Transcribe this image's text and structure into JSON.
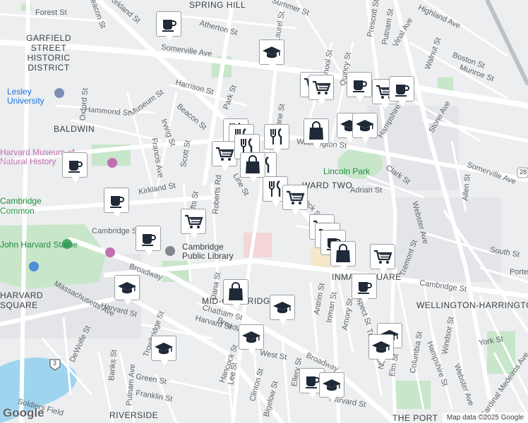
{
  "map": {
    "labels": {
      "district_garfield": "GARFIELD STREET HISTORIC DISTRICT",
      "baldwin": "BALDWIN",
      "spring_hill": "SPRING HILL",
      "ward_two": "WARD TWO",
      "mid_cambridge": "MID-CAMBRIDGE",
      "inman_square": "INMAN SQUARE",
      "wellington_harrington": "WELLINGTON-HARRINGTON",
      "riverside": "RIVERSIDE",
      "the_port": "THE PORT",
      "harvard_square": "HARVARD SQUARE",
      "lesley_university": "Lesley University",
      "harvard_museum": "Harvard Museum of Natural History",
      "cambridge_common": "Cambridge Common",
      "harvard_statue": "John Harvard Statue",
      "cambridge_public_library": "Cambridge Public Library",
      "lincoln_park": "Lincoln Park",
      "route_28": "28",
      "route_3": "3"
    },
    "streets": {
      "forest_st": "Forest St",
      "beacon_st_top": "Beacon St",
      "kirkland_st_top": "Kirkland St",
      "summer_st": "Summer St",
      "highland_ave": "Highland Ave",
      "atherton_st": "Atherton St",
      "laurel_st": "Laurel St",
      "prescott_st": "Prescott St",
      "putnam_st": "Putnam St",
      "vinal_ave": "Vinal Ave",
      "somerville_ave_top": "Somerville Ave",
      "walnut_st": "Walnut St",
      "boston_st": "Boston St",
      "munroe_st": "Munroe St",
      "school_st": "School St",
      "quincy_st": "Quincy St",
      "harrison_st": "Harrison St",
      "park_st": "Park St",
      "beacon_st_mid": "Beacon St",
      "oxford_st": "Oxford St",
      "hammond_st": "Hammond St",
      "museum_st": "Museum St",
      "irving_st": "Irving St",
      "francis_ave": "Francis Ave",
      "scott_st": "Scott St",
      "washington_st": "Washington St",
      "lane_st": "Lane St",
      "stone_ave": "Stone Ave",
      "clark_st": "Clark St",
      "adrian_st": "Adrian St",
      "somerville_ave_right": "Somerville Ave",
      "webster_ave": "Webster Ave",
      "allen_st": "Allen St",
      "kirkland_st": "Kirkland St",
      "line_st": "Line St",
      "tufts_st": "Tufts St",
      "roberts_rd": "Roberts Rd",
      "beck_st": "Beck St",
      "cambridge_st_left": "Cambridge St",
      "broadway_left": "Broadway",
      "dana_st": "Dana St",
      "massachusetts_ave": "Massachusetts Ave",
      "harvard_st_left": "Harvard St",
      "trowbridge_st": "Trowbridge St",
      "dewolfe_st": "DeWolfe St",
      "banks_st": "Banks St",
      "putnam_ave": "Putnam Ave",
      "green_st": "Green St",
      "franklin_st": "Franklin St",
      "soldiers_field": "Soldiers Field",
      "chatham_st": "Chatham St",
      "harvard_st_mid": "Harvard St",
      "hancock_st": "Hancock St",
      "lee_st": "Lee St",
      "clinton_st": "Clinton St",
      "bigelow_st": "Bigelow St",
      "west_st": "West St",
      "broadway_mid": "Broadway",
      "ellery_st": "Ellery St",
      "antrim_st": "Antrim St",
      "inman_st": "Inman St",
      "amory_st": "Amory St",
      "prospect_st": "Prospect St",
      "tremont_st": "Tremont St",
      "cambridge_st_right": "Cambridge St",
      "south_st": "South St",
      "porter_st": "Porter St",
      "columbia_st": "Columbia St",
      "hampshire_st": "Hampshire St",
      "windsor_st": "Windsor St",
      "webster_ave_low": "Webster Ave",
      "york_st": "York St",
      "cardinal_medeiros": "Cardinal Medeiros Ave",
      "norfolk_st": "Norfolk St",
      "elm_st": "Elm St",
      "tremont_st_low": "Tremont St",
      "harvard_st_low": "Harvard St",
      "broadway_low": "Broadway",
      "hampshire_st_top": "Hampshire St"
    }
  },
  "markers": [
    {
      "type": "cafe-icon"
    },
    {
      "type": "school-icon"
    },
    {
      "type": "grocery-icon"
    },
    {
      "type": "grocery-icon"
    },
    {
      "type": "cafe-icon"
    },
    {
      "type": "grocery-icon"
    },
    {
      "type": "cafe-icon"
    },
    {
      "type": "restaurant-icon"
    },
    {
      "type": "restaurant-icon"
    },
    {
      "type": "grocery-icon"
    },
    {
      "type": "restaurant-icon"
    },
    {
      "type": "restaurant-icon"
    },
    {
      "type": "restaurant-icon"
    },
    {
      "type": "shopping-bag-icon"
    },
    {
      "type": "school-icon"
    },
    {
      "type": "school-icon"
    },
    {
      "type": "cafe-icon"
    },
    {
      "type": "cafe-icon"
    },
    {
      "type": "cafe-icon"
    },
    {
      "type": "grocery-icon"
    },
    {
      "type": "restaurant-icon"
    },
    {
      "type": "shopping-bag-icon"
    },
    {
      "type": "grocery-icon"
    },
    {
      "type": "school-icon"
    },
    {
      "type": "shopping-bag-icon"
    },
    {
      "type": "school-icon"
    },
    {
      "type": "school-icon"
    },
    {
      "type": "school-icon"
    },
    {
      "type": "grocery-icon"
    },
    {
      "type": "grocery-icon"
    },
    {
      "type": "cafe-icon"
    },
    {
      "type": "shopping-bag-icon"
    },
    {
      "type": "grocery-icon"
    },
    {
      "type": "cafe-icon"
    },
    {
      "type": "school-icon"
    },
    {
      "type": "school-icon"
    },
    {
      "type": "cafe-icon"
    },
    {
      "type": "school-icon"
    }
  ],
  "footer": {
    "brand": "Google",
    "attribution": "Map data ©2025 Google"
  }
}
